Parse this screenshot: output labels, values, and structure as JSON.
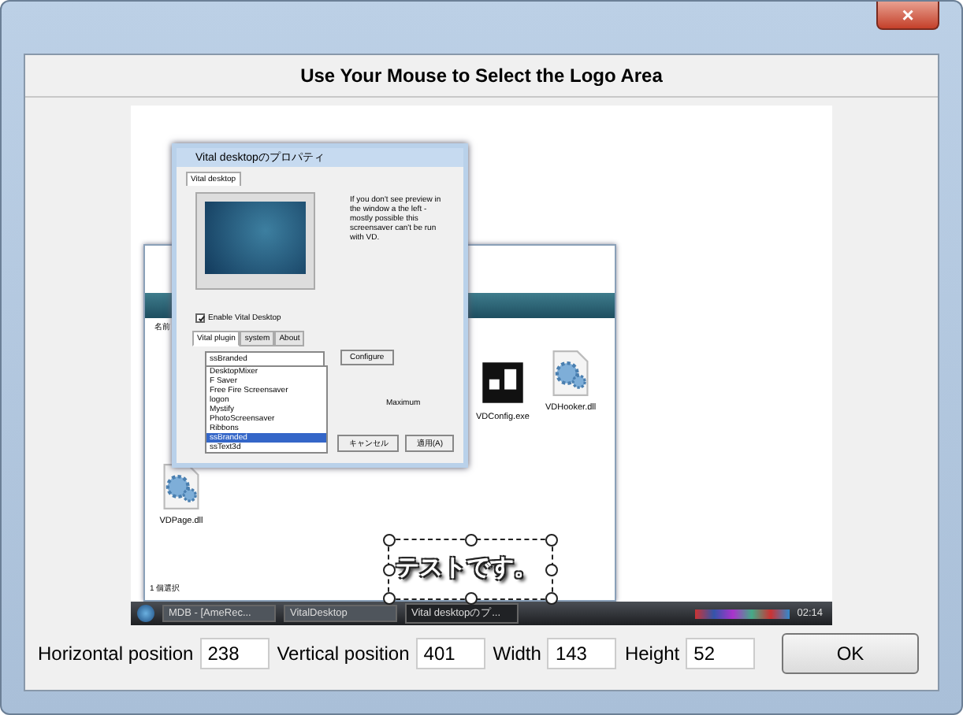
{
  "window": {
    "title": "Use Your Mouse to Select the Logo Area",
    "close": "×"
  },
  "preview": {
    "property_window": {
      "title": "Vital desktopのプロパティ",
      "tab": "Vital desktop",
      "note": "If you don't see preview in the window a the left - mostly possible this screensaver can't be run with VD.",
      "enable": {
        "label": "Enable Vital Desktop",
        "checked": true
      },
      "tabs": [
        {
          "label": "Vital plugin",
          "selected": true
        },
        {
          "label": "system",
          "selected": false
        },
        {
          "label": "About",
          "selected": false
        }
      ],
      "dropdown": "ssBranded",
      "configure": "Configure",
      "maximum": "Maximum",
      "list": [
        {
          "label": "DesktopMixer",
          "selected": false
        },
        {
          "label": "F Saver",
          "selected": false
        },
        {
          "label": "Free Fire Screensaver",
          "selected": false
        },
        {
          "label": "logon",
          "selected": false
        },
        {
          "label": "Mystify",
          "selected": false
        },
        {
          "label": "PhotoScreensaver",
          "selected": false
        },
        {
          "label": "Ribbons",
          "selected": false
        },
        {
          "label": "ssBranded",
          "selected": true
        },
        {
          "label": "ssText3d",
          "selected": false
        }
      ],
      "buttons": [
        "キャンセル",
        "適用(A)"
      ]
    },
    "explorer": {
      "column": "名前",
      "files": [
        {
          "name": "VDConfig.exe",
          "kind": "app"
        },
        {
          "name": "VDHooker.dll",
          "kind": "dll"
        },
        {
          "name": "VDPage.dll",
          "kind": "dll"
        }
      ],
      "status": "1 個選択"
    },
    "taskbar": {
      "items": [
        {
          "label": "MDB - [AmeRec...",
          "selected": false
        },
        {
          "label": "VitalDesktop",
          "selected": false
        },
        {
          "label": "Vital desktopのプ...",
          "selected": true
        }
      ],
      "clock": "02:14"
    },
    "logo": "テストです。"
  },
  "fields": [
    {
      "label": "Horizontal position",
      "value": "238"
    },
    {
      "label": "Vertical position",
      "value": "401"
    },
    {
      "label": "Width",
      "value": "143"
    },
    {
      "label": "Height",
      "value": "52"
    }
  ],
  "ok": "OK"
}
